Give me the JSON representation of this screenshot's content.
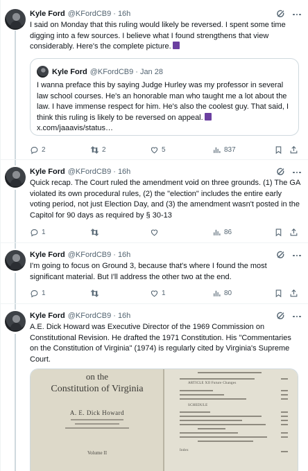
{
  "tweets": [
    {
      "name": "Kyle Ford",
      "handle": "@KFordCB9",
      "time": "16h",
      "text": "I said on Monday that this ruling would likely be reversed. I spent some time digging into a few sources. I believe what I found strengthens that view considerably. Here's the complete picture.",
      "quote": {
        "name": "Kyle Ford",
        "handle": "@KFordCB9",
        "time": "Jan 28",
        "text": "I wanna preface this by saying Judge Hurley was my professor in several law school courses. He's an honorable man who taught me a lot about the law. I have immense respect for him. He's also the coolest guy. That said, I think this ruling is likely to be reversed on appeal.",
        "link": "x.com/jaaavis/status…"
      },
      "replies": "2",
      "retweets": "2",
      "likes": "5",
      "views": "837"
    },
    {
      "name": "Kyle Ford",
      "handle": "@KFordCB9",
      "time": "16h",
      "text": "Quick recap. The Court ruled the amendment void on three grounds. (1) The GA violated its own procedural rules, (2) the \"election\" includes the entire early voting period, not just Election Day, and (3) the amendment wasn't posted in the Capitol for 90 days as required by § 30-13",
      "replies": "1",
      "retweets": "",
      "likes": "",
      "views": "86"
    },
    {
      "name": "Kyle Ford",
      "handle": "@KFordCB9",
      "time": "16h",
      "text": "I'm going to focus on Ground 3, because that's where I found the most significant material. But I'll address the other two at the end.",
      "replies": "1",
      "retweets": "",
      "likes": "1",
      "views": "80"
    },
    {
      "name": "Kyle Ford",
      "handle": "@KFordCB9",
      "time": "16h",
      "text": "A.E. Dick Howard was Executive Director of the 1969 Commission on Constitutional Revision. He drafted the 1971 Constitution. His \"Commentaries on the Constitution of Virginia\" (1974) is regularly cited by Virginia's Supreme Court.",
      "media": {
        "book_title_line1": "on the",
        "book_title_line2": "Constitution of Virginia",
        "book_author": "A. E. Dick Howard",
        "book_volume": "Volume II",
        "toc_heading_1": "ARTICLE XII  Future Changes",
        "toc_heading_2": "SCHEDULE",
        "toc_index": "Index"
      }
    }
  ],
  "dot": "·"
}
